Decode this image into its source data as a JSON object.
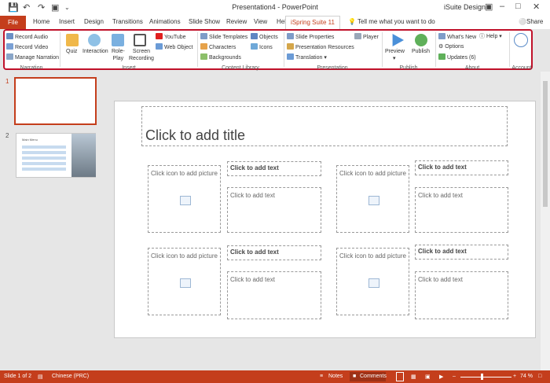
{
  "app": {
    "doc_title": "Presentation4  -  PowerPoint",
    "user": "iSuite Design",
    "share": "Share"
  },
  "tabs": [
    "File",
    "Home",
    "Insert",
    "Design",
    "Transitions",
    "Animations",
    "Slide Show",
    "Review",
    "View",
    "Help",
    "iSpring Suite 11"
  ],
  "tell_me": "Tell me what you want to do",
  "ribbon": {
    "narration": {
      "record_audio": "Record Audio",
      "record_video": "Record Video",
      "manage_narration": "Manage Narration",
      "group": "Narration"
    },
    "insert": {
      "quiz": "Quiz",
      "interaction": "Interaction",
      "role_play": "Role-\nPlay",
      "screen_recording": "Screen\nRecording",
      "youtube": "YouTube",
      "web_object": "Web Object",
      "group": "Insert"
    },
    "content_library": {
      "slide_templates": "Slide Templates",
      "objects": "Objects",
      "characters": "Characters",
      "icons": "Icons",
      "backgrounds": "Backgrounds",
      "group": "Content Library"
    },
    "presentation": {
      "slide_properties": "Slide Properties",
      "player": "Player",
      "presentation_resources": "Presentation Resources",
      "translation": "Translation",
      "group": "Presentation"
    },
    "publish": {
      "preview": "Preview",
      "publish": "Publish",
      "group": "Publish"
    },
    "about": {
      "whats_new": "What's New",
      "help": "Help",
      "options": "Options",
      "updates": "Updates (6)",
      "group": "About"
    },
    "account": {
      "group": "Account"
    }
  },
  "thumbnails": [
    {
      "num": "1"
    },
    {
      "num": "2",
      "title": "Main Menu"
    }
  ],
  "slide": {
    "title_placeholder": "Click to add title",
    "picture_placeholder": "Click icon to add picture",
    "bold_text_placeholder": "Click to add text",
    "text_placeholder": "Click to add text"
  },
  "status": {
    "slide": "Slide 1 of 2",
    "language": "Chinese (PRC)",
    "notes": "Notes",
    "comments": "Comments",
    "zoom": "74 %"
  },
  "colors": {
    "accent": "#c43e1c",
    "highlight": "#c0112a"
  }
}
